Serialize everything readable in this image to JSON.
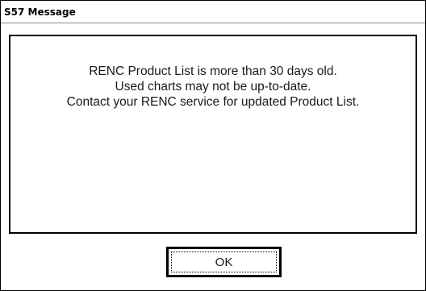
{
  "dialog": {
    "title": "S57 Message",
    "message_lines": [
      "RENC Product List is more than 30 days old.",
      "Used charts may not be up-to-date.",
      "Contact your RENC service for updated Product List."
    ],
    "ok_label": "OK"
  }
}
